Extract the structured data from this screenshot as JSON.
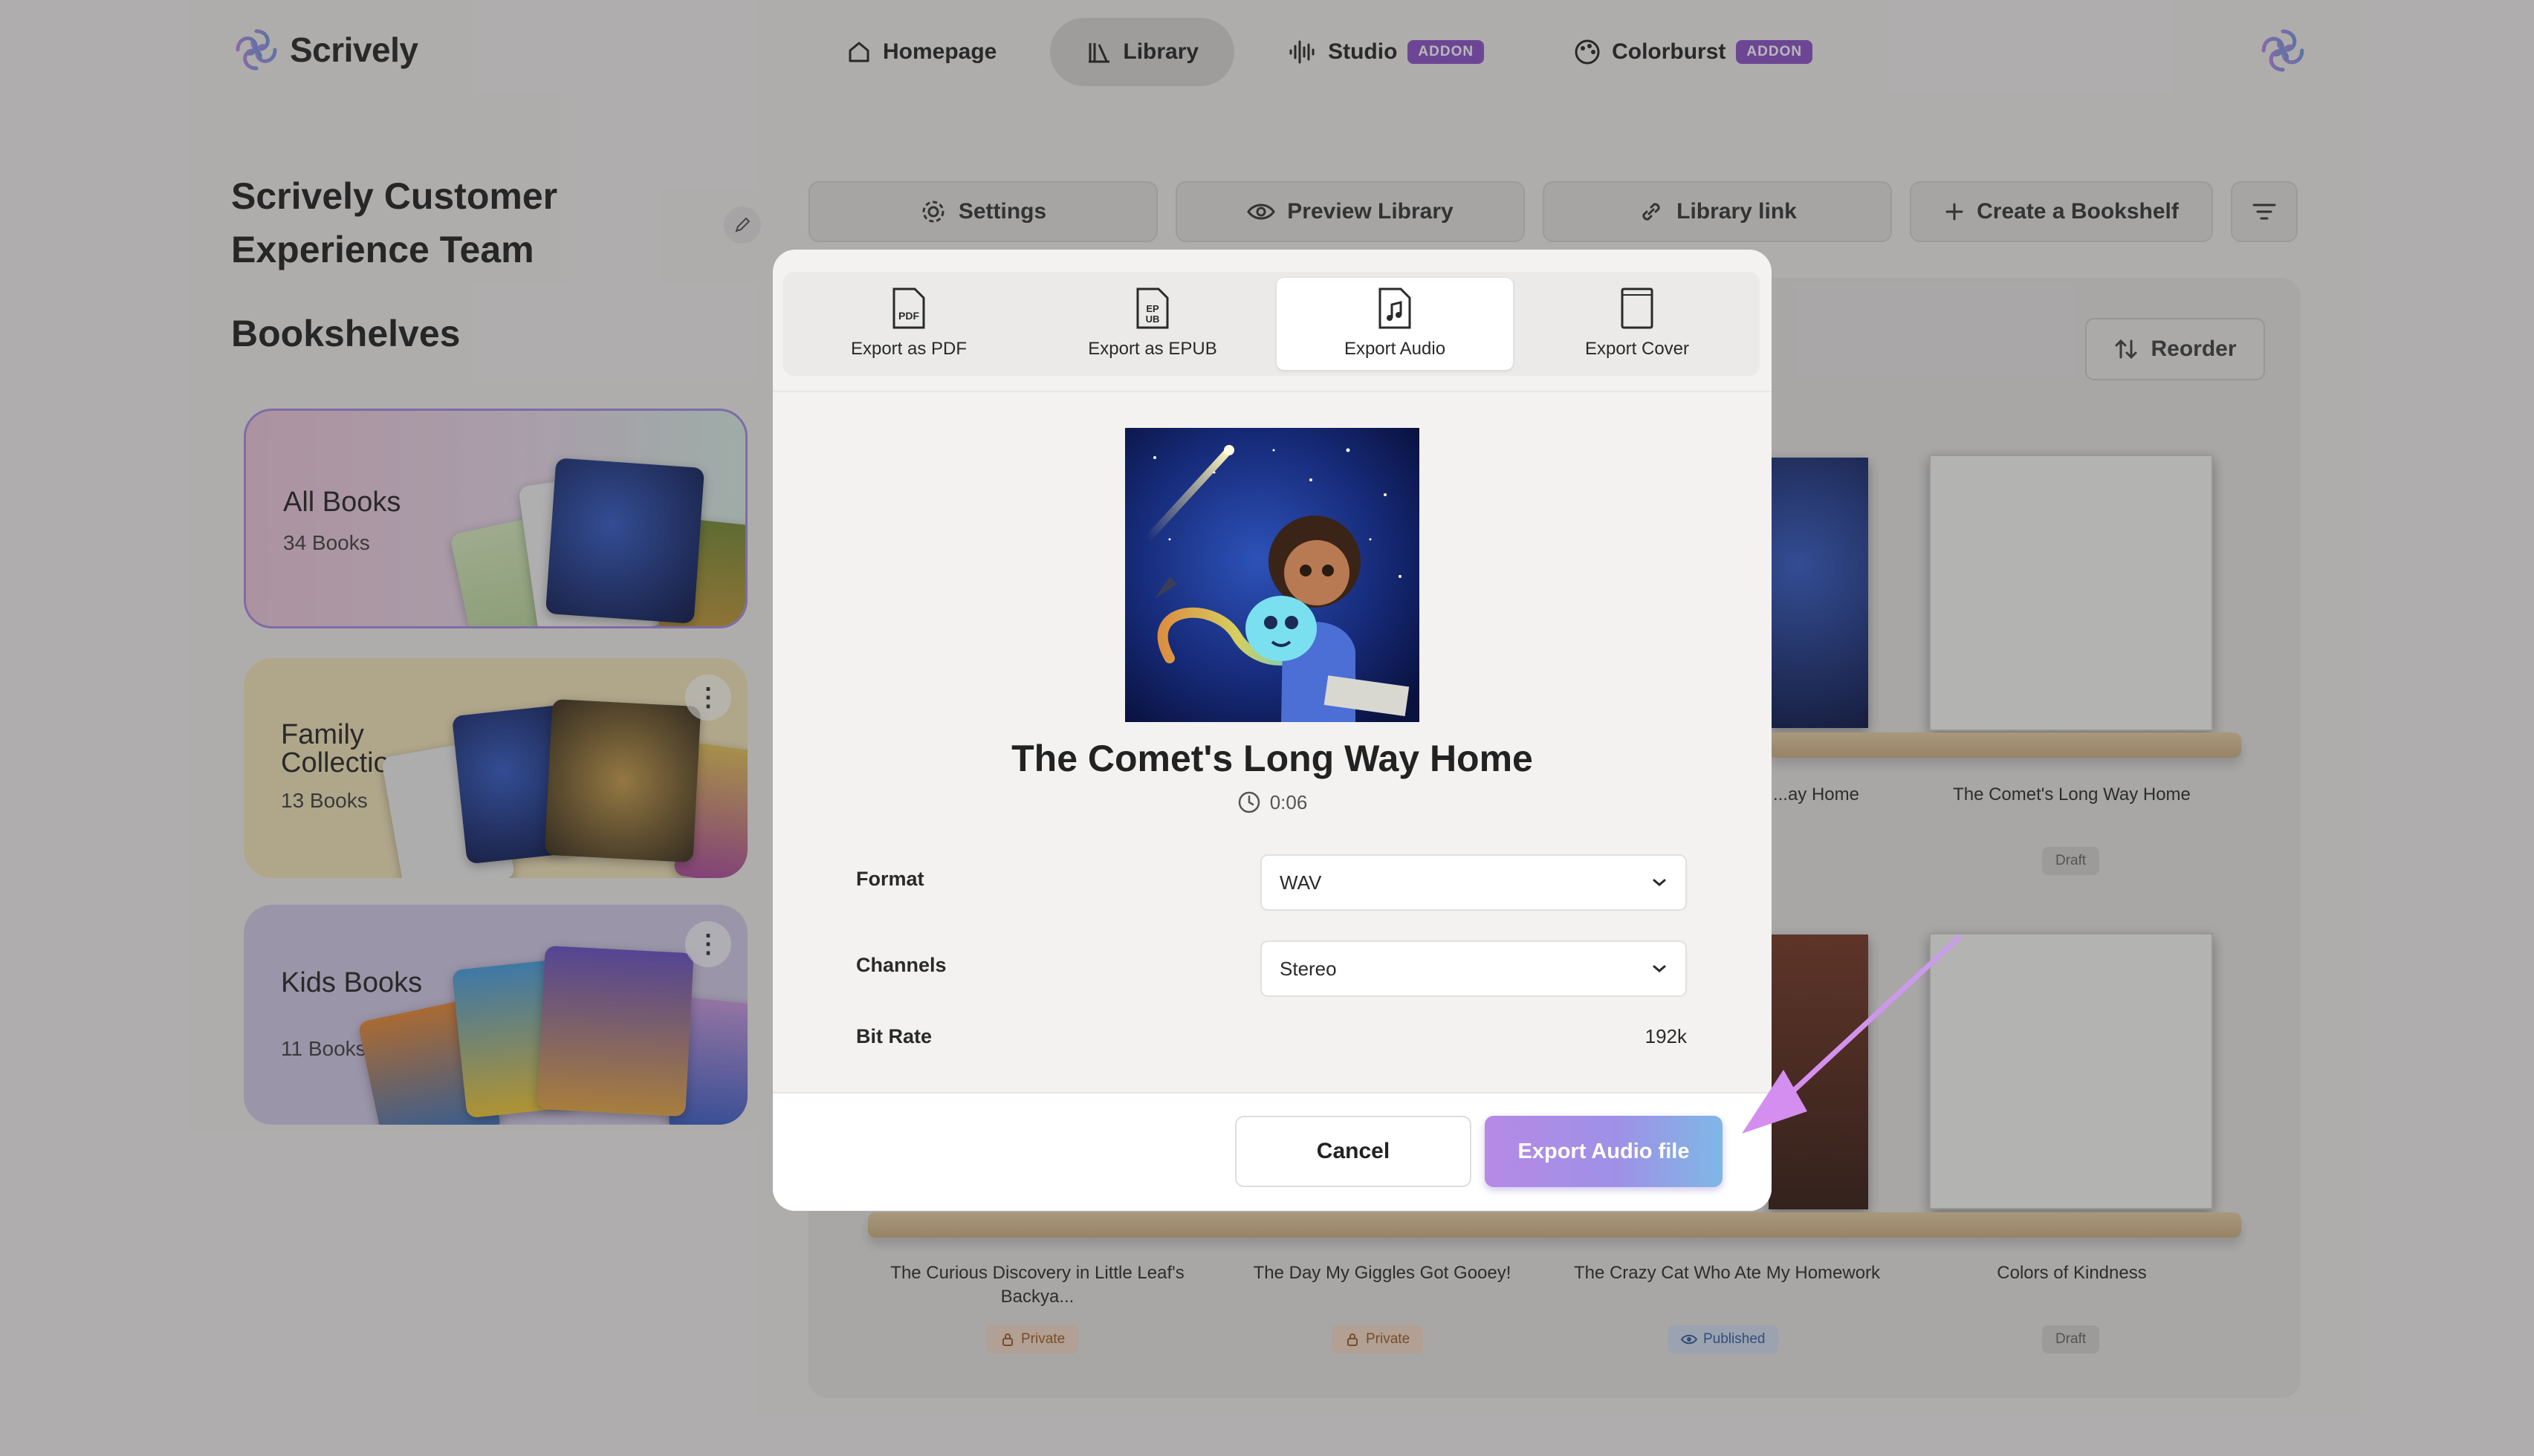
{
  "brand": {
    "name": "Scrively"
  },
  "nav": {
    "items": [
      {
        "label": "Homepage",
        "icon": "home-icon",
        "badge": ""
      },
      {
        "label": "Library",
        "icon": "library-icon",
        "badge": ""
      },
      {
        "label": "Studio",
        "icon": "audio-wave-icon",
        "badge": "ADDON"
      },
      {
        "label": "Colorburst",
        "icon": "palette-icon",
        "badge": "ADDON"
      }
    ],
    "active": "Library"
  },
  "sidebar": {
    "team_name": "Scrively Customer Experience Team",
    "bookshelves_title": "Bookshelves",
    "shelves": [
      {
        "title": "All Books",
        "count": "34 Books"
      },
      {
        "title": "Family Collection",
        "count": "13 Books"
      },
      {
        "title": "Kids Books",
        "count": "11 Books"
      }
    ]
  },
  "toolbar": {
    "settings": "Settings",
    "preview": "Preview Library",
    "link": "Library link",
    "create": "Create a Bookshelf"
  },
  "library": {
    "reorder": "Reorder",
    "row1": [
      {
        "title": "The Comet's Long Way Home",
        "status": "Draft"
      }
    ],
    "partial_title": "...ay Home",
    "row2": [
      {
        "title": "The Curious Discovery in Little Leaf's Backya...",
        "status": "Private"
      },
      {
        "title": "The Day My Giggles Got Gooey!",
        "status": "Private"
      },
      {
        "title": "The Crazy Cat Who Ate My Homework",
        "status": "Published"
      },
      {
        "title": "Colors of Kindness",
        "status": "Draft"
      }
    ]
  },
  "modal": {
    "tabs": [
      {
        "label": "Export as PDF",
        "icon": "pdf-file-icon"
      },
      {
        "label": "Export as EPUB",
        "icon": "epub-file-icon"
      },
      {
        "label": "Export Audio",
        "icon": "audio-file-icon"
      },
      {
        "label": "Export Cover",
        "icon": "cover-file-icon"
      }
    ],
    "active_tab": "Export Audio",
    "book_title": "The Comet's Long Way Home",
    "duration": "0:06",
    "fields": {
      "format_label": "Format",
      "format_value": "WAV",
      "channels_label": "Channels",
      "channels_value": "Stereo",
      "bitrate_label": "Bit Rate",
      "bitrate_value": "192k"
    },
    "cancel": "Cancel",
    "submit": "Export Audio file"
  },
  "colors": {
    "accent_purple": "#8e55c9",
    "export_gradient_start": "#b68ae6",
    "export_gradient_end": "#7fb7e6"
  }
}
